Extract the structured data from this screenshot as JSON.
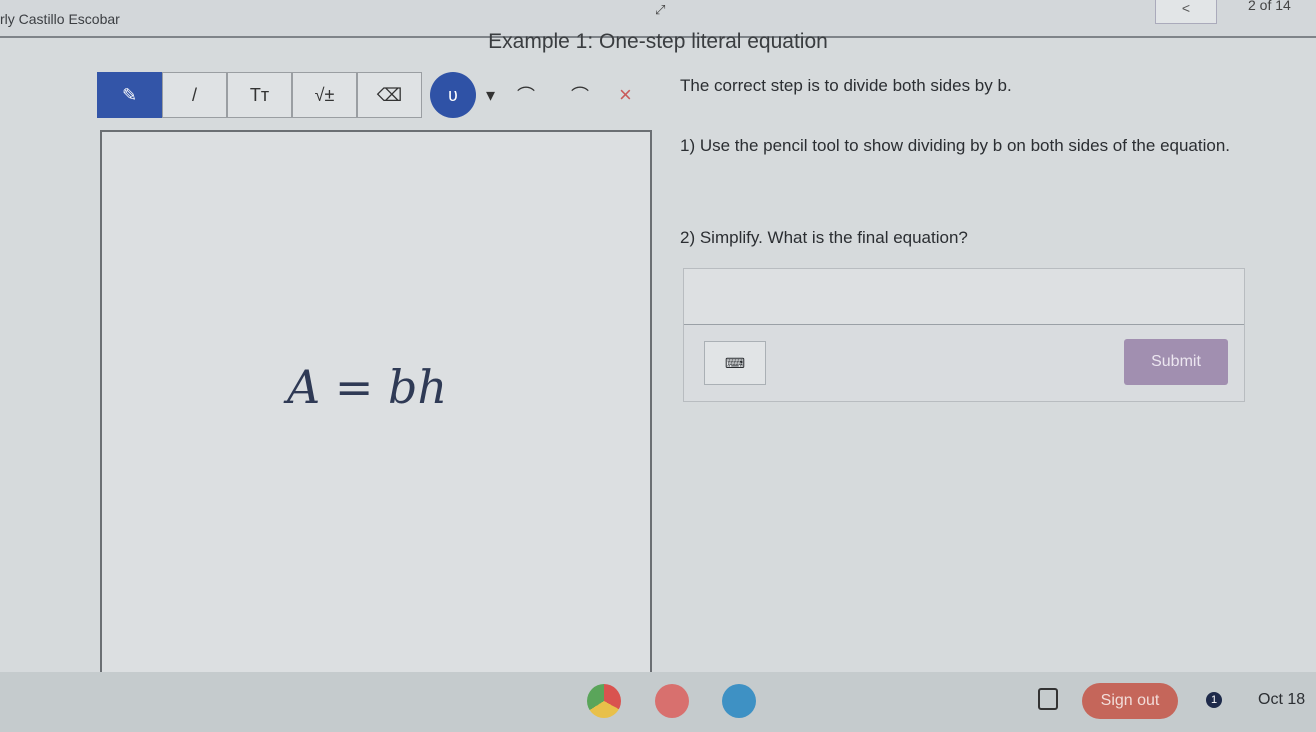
{
  "header": {
    "user": "rly Castillo Escobar",
    "prev_label": "<",
    "pager": "2 of 14"
  },
  "title": "Example 1: One-step literal equation",
  "toolbar": {
    "tools": [
      {
        "name": "pencil",
        "glyph": "✎"
      },
      {
        "name": "line",
        "glyph": "/"
      },
      {
        "name": "text",
        "glyph": "Tт"
      },
      {
        "name": "math",
        "glyph": "√±"
      },
      {
        "name": "eraser",
        "glyph": "⌫"
      }
    ],
    "color_glyph": "ʋ",
    "dropdown": "▾",
    "undo": "⌒",
    "redo": "⌒",
    "clear": "×",
    "active_color": "#2f52a6"
  },
  "canvas": {
    "equation": "A = bh"
  },
  "instructions": {
    "hint": "The correct step is to divide both sides by b.",
    "step1": "1) Use the pencil tool to show dividing by b on both sides of the equation.",
    "step2": "2) Simplify. What is the final equation?"
  },
  "answer": {
    "value": "",
    "keyboard_glyph": "⌨",
    "submit": "Submit"
  },
  "shelf": {
    "apps": [
      "chrome",
      "app-red",
      "app-blue"
    ],
    "sign_out": "Sign out",
    "notifications": "1",
    "date": "Oct 18"
  }
}
